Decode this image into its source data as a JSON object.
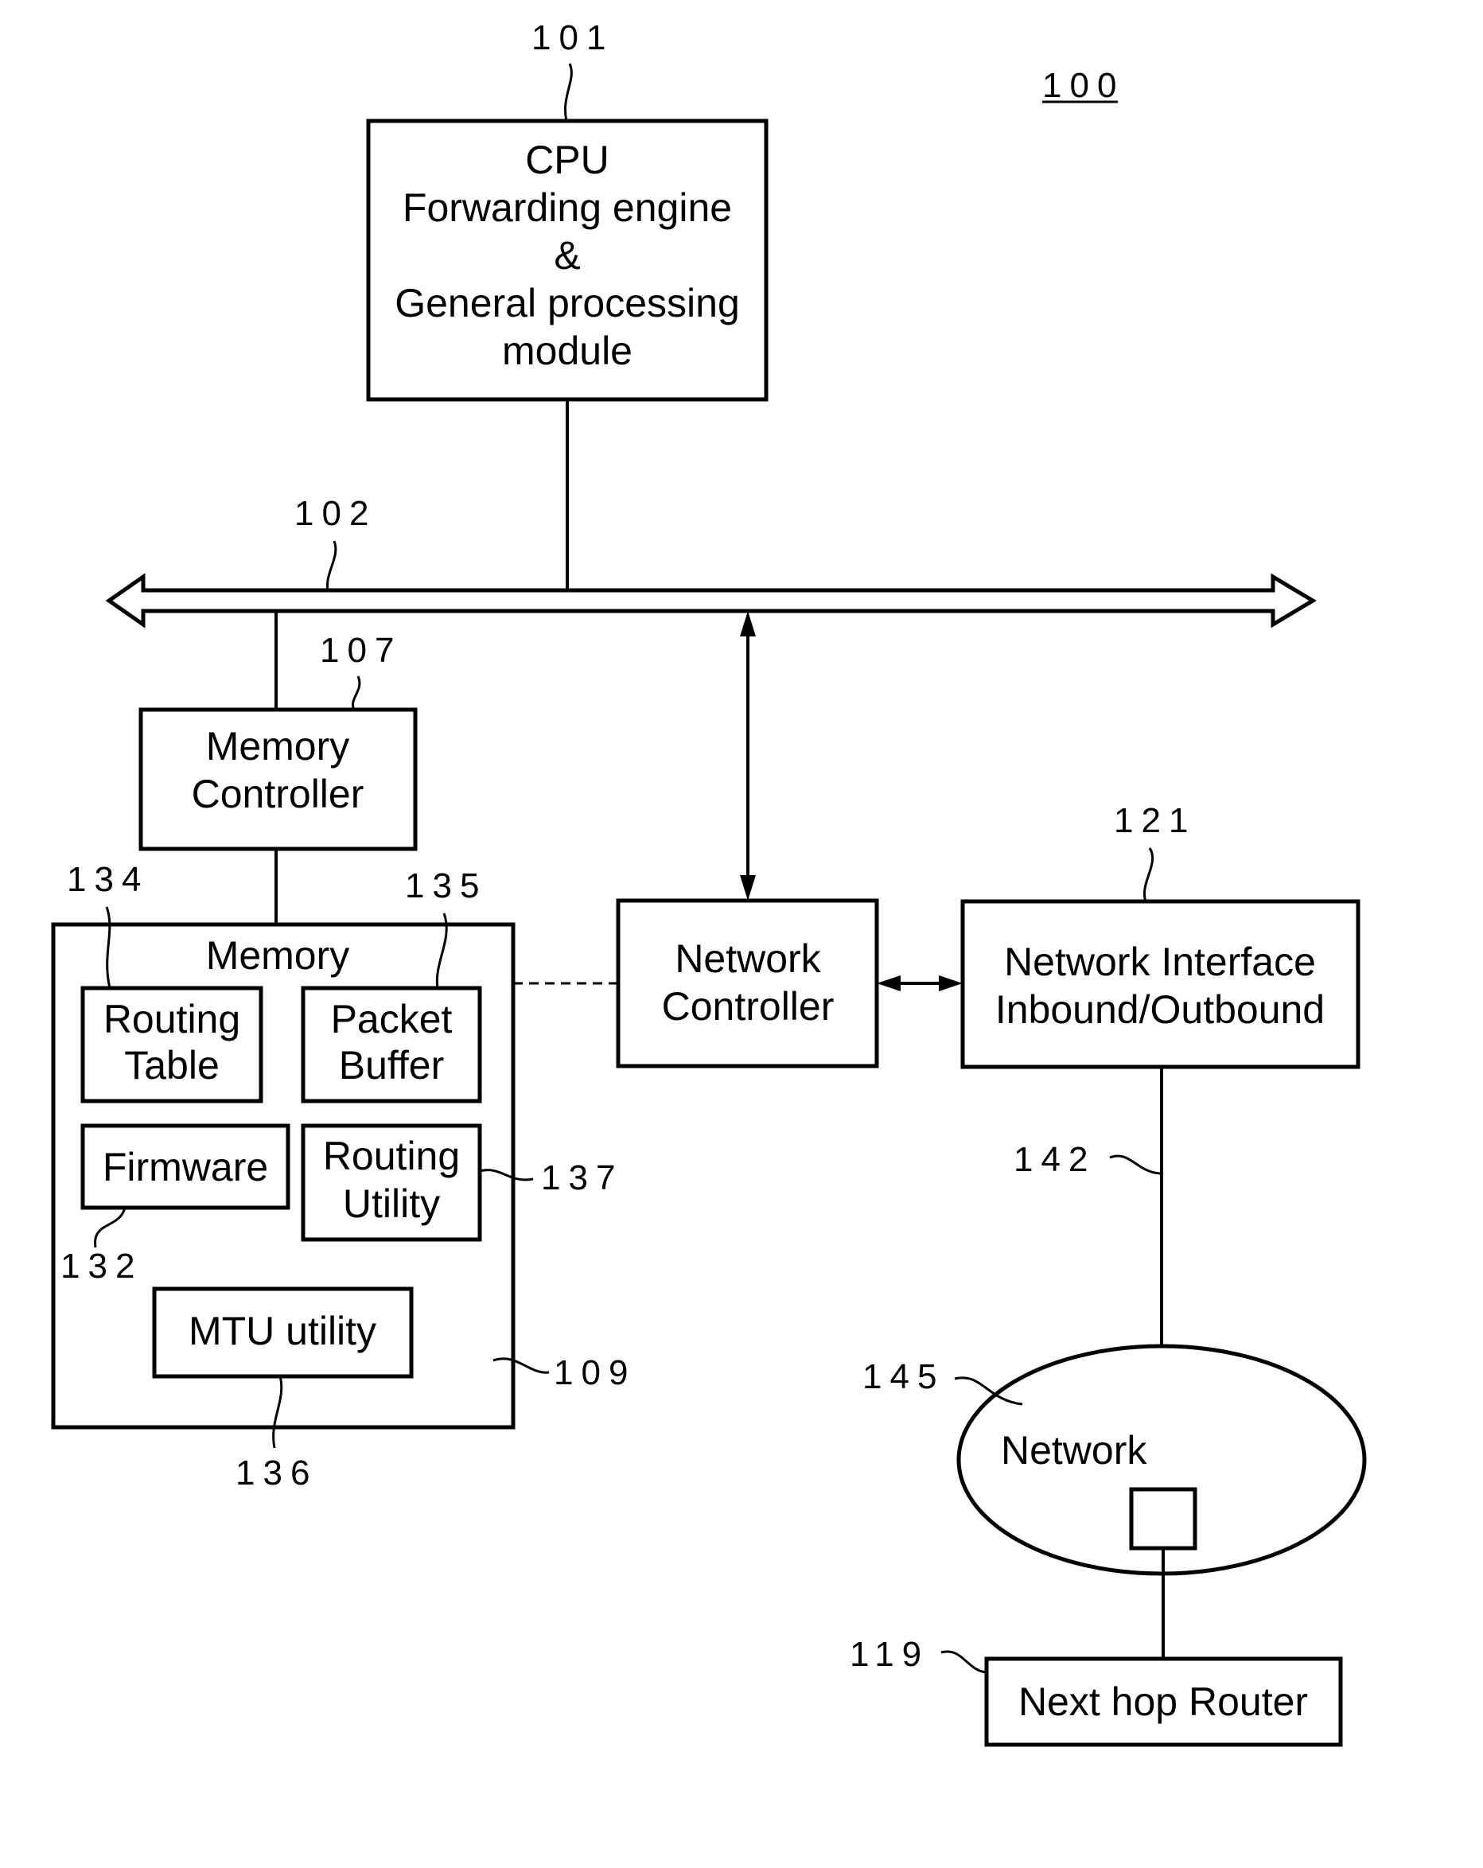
{
  "figure": {
    "number": "100",
    "colors": {
      "ink": "#000000",
      "background": "#ffffff"
    }
  },
  "blocks": {
    "cpu": {
      "ref": "101",
      "lines": [
        "CPU",
        "Forwarding engine",
        "&",
        "General processing",
        "module"
      ]
    },
    "bus": {
      "ref": "102"
    },
    "memory_controller": {
      "ref": "107",
      "lines": [
        "Memory",
        "Controller"
      ]
    },
    "memory": {
      "ref": "109",
      "title": "Memory"
    },
    "routing_table": {
      "ref": "134",
      "lines": [
        "Routing",
        "Table"
      ]
    },
    "packet_buffer": {
      "ref": "135",
      "lines": [
        "Packet",
        "Buffer"
      ]
    },
    "firmware": {
      "ref": "132",
      "lines": [
        "Firmware"
      ]
    },
    "routing_utility": {
      "ref": "137",
      "lines": [
        "Routing",
        "Utility"
      ]
    },
    "mtu_utility": {
      "ref": "136",
      "lines": [
        "MTU utility"
      ]
    },
    "network_controller": {
      "ref": "",
      "lines": [
        "Network",
        "Controller"
      ]
    },
    "network_interface": {
      "ref": "121",
      "lines": [
        "Network Interface",
        "Inbound/Outbound"
      ]
    },
    "link": {
      "ref": "142"
    },
    "network": {
      "ref": "145",
      "label": "Network"
    },
    "next_hop_router": {
      "ref": "119",
      "lines": [
        "Next hop Router"
      ]
    }
  }
}
